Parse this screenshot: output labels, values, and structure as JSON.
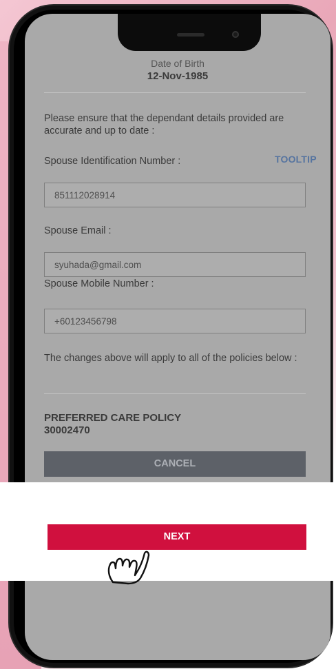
{
  "profile": {
    "dob_label": "Date of Birth",
    "dob_value": "12-Nov-1985"
  },
  "dependants": {
    "intro": "Please ensure that the dependant details provided are accurate and up to date :",
    "spouse_id_label": "Spouse Identification Number :",
    "tooltip_label": "TOOLTIP",
    "spouse_id_value": "851112028914",
    "spouse_email_label": "Spouse Email :",
    "spouse_email_value": "syuhada@gmail.com",
    "spouse_mobile_label": "Spouse Mobile Number :",
    "spouse_mobile_value": "+60123456798",
    "apply_note": "The changes above will apply to all of the policies below :"
  },
  "policy": {
    "name": "PREFERRED CARE POLICY",
    "number": "30002470"
  },
  "actions": {
    "cancel_label": "CANCEL",
    "next_label": "NEXT"
  },
  "colors": {
    "accent": "#d0103e",
    "cancel_bg": "#5d6168",
    "tooltip": "#5674a0",
    "background": "#f0c2ce"
  },
  "icons": {
    "pointer": "hand-tap-icon"
  }
}
